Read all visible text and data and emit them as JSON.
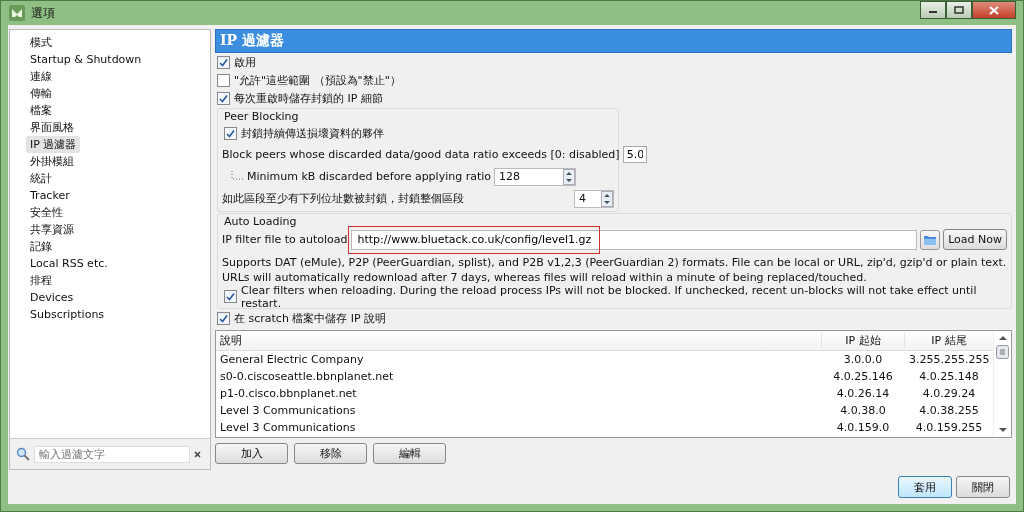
{
  "window": {
    "title": "選項"
  },
  "sidebar": {
    "items": [
      {
        "label": "模式",
        "selected": false
      },
      {
        "label": "Startup & Shutdown",
        "selected": false
      },
      {
        "label": "連線",
        "selected": false
      },
      {
        "label": "傳輸",
        "selected": false
      },
      {
        "label": "檔案",
        "selected": false
      },
      {
        "label": "界面風格",
        "selected": false
      },
      {
        "label": "IP 過濾器",
        "selected": true
      },
      {
        "label": "外掛模組",
        "selected": false
      },
      {
        "label": "統計",
        "selected": false
      },
      {
        "label": "Tracker",
        "selected": false
      },
      {
        "label": "安全性",
        "selected": false
      },
      {
        "label": "共享資源",
        "selected": false
      },
      {
        "label": "記錄",
        "selected": false
      },
      {
        "label": "Local RSS etc.",
        "selected": false
      },
      {
        "label": "排程",
        "selected": false
      },
      {
        "label": "Devices",
        "selected": false
      },
      {
        "label": "Subscriptions",
        "selected": false
      }
    ],
    "filter": {
      "placeholder": "輸入過濾文字"
    }
  },
  "page_title": "IP 過濾器",
  "options": [
    {
      "label": "啟用",
      "checked": true
    },
    {
      "label": "\"允許\"這些範圍 （預設為\"禁止\"）",
      "checked": false
    },
    {
      "label": "每次重啟時儲存封鎖的 IP 細節",
      "checked": true
    }
  ],
  "peer_blocking": {
    "title": "Peer Blocking",
    "option": {
      "label": "封鎖持續傳送損壞資料的夥伴",
      "checked": true
    },
    "ratio": {
      "label": "Block peers whose discarded data/good data ratio exceeds [0: disabled]",
      "value": "5.0"
    },
    "minimum": {
      "label": "Minimum kB discarded before applying ratio",
      "value": "128"
    },
    "range": {
      "label": "如此區段至少有下列位址數被封鎖，封鎖整個區段",
      "value": "4"
    }
  },
  "auto_loading": {
    "title": "Auto Loading",
    "file_label": "IP filter file to autoload",
    "file_value": "http://www.bluetack.co.uk/config/level1.gz",
    "highlighted": true,
    "load_button": "Load Now",
    "description": "Supports DAT (eMule), P2P (PeerGuardian, splist), and P2B v1,2,3 (PeerGuardian 2) formats.  File can be local or URL, zip'd, gzip'd or plain text.  URLs will automatically redownload after 7 days, whereas files will reload within a minute of being replaced/touched.",
    "clear": {
      "label": "Clear filters when reloading. During the reload process IPs will not be blocked. If unchecked, recent un-blocks will not take effect until restart.",
      "checked": true
    }
  },
  "store_option": {
    "label": "在 scratch 檔案中儲存 IP 說明",
    "checked": true
  },
  "table": {
    "columns": [
      "說明",
      "IP 起始",
      "IP 結尾"
    ],
    "rows": [
      [
        "General Electric Company",
        "3.0.0.0",
        "3.255.255.255"
      ],
      [
        "s0-0.ciscoseattle.bbnplanet.net",
        "4.0.25.146",
        "4.0.25.148"
      ],
      [
        "p1-0.cisco.bbnplanet.net",
        "4.0.26.14",
        "4.0.29.24"
      ],
      [
        "Level 3 Communications",
        "4.0.38.0",
        "4.0.38.255"
      ],
      [
        "Level 3 Communications",
        "4.0.159.0",
        "4.0.159.255"
      ]
    ]
  },
  "table_buttons": [
    "加入",
    "移除",
    "編輯"
  ],
  "footer_buttons": [
    "套用",
    "關閉"
  ]
}
